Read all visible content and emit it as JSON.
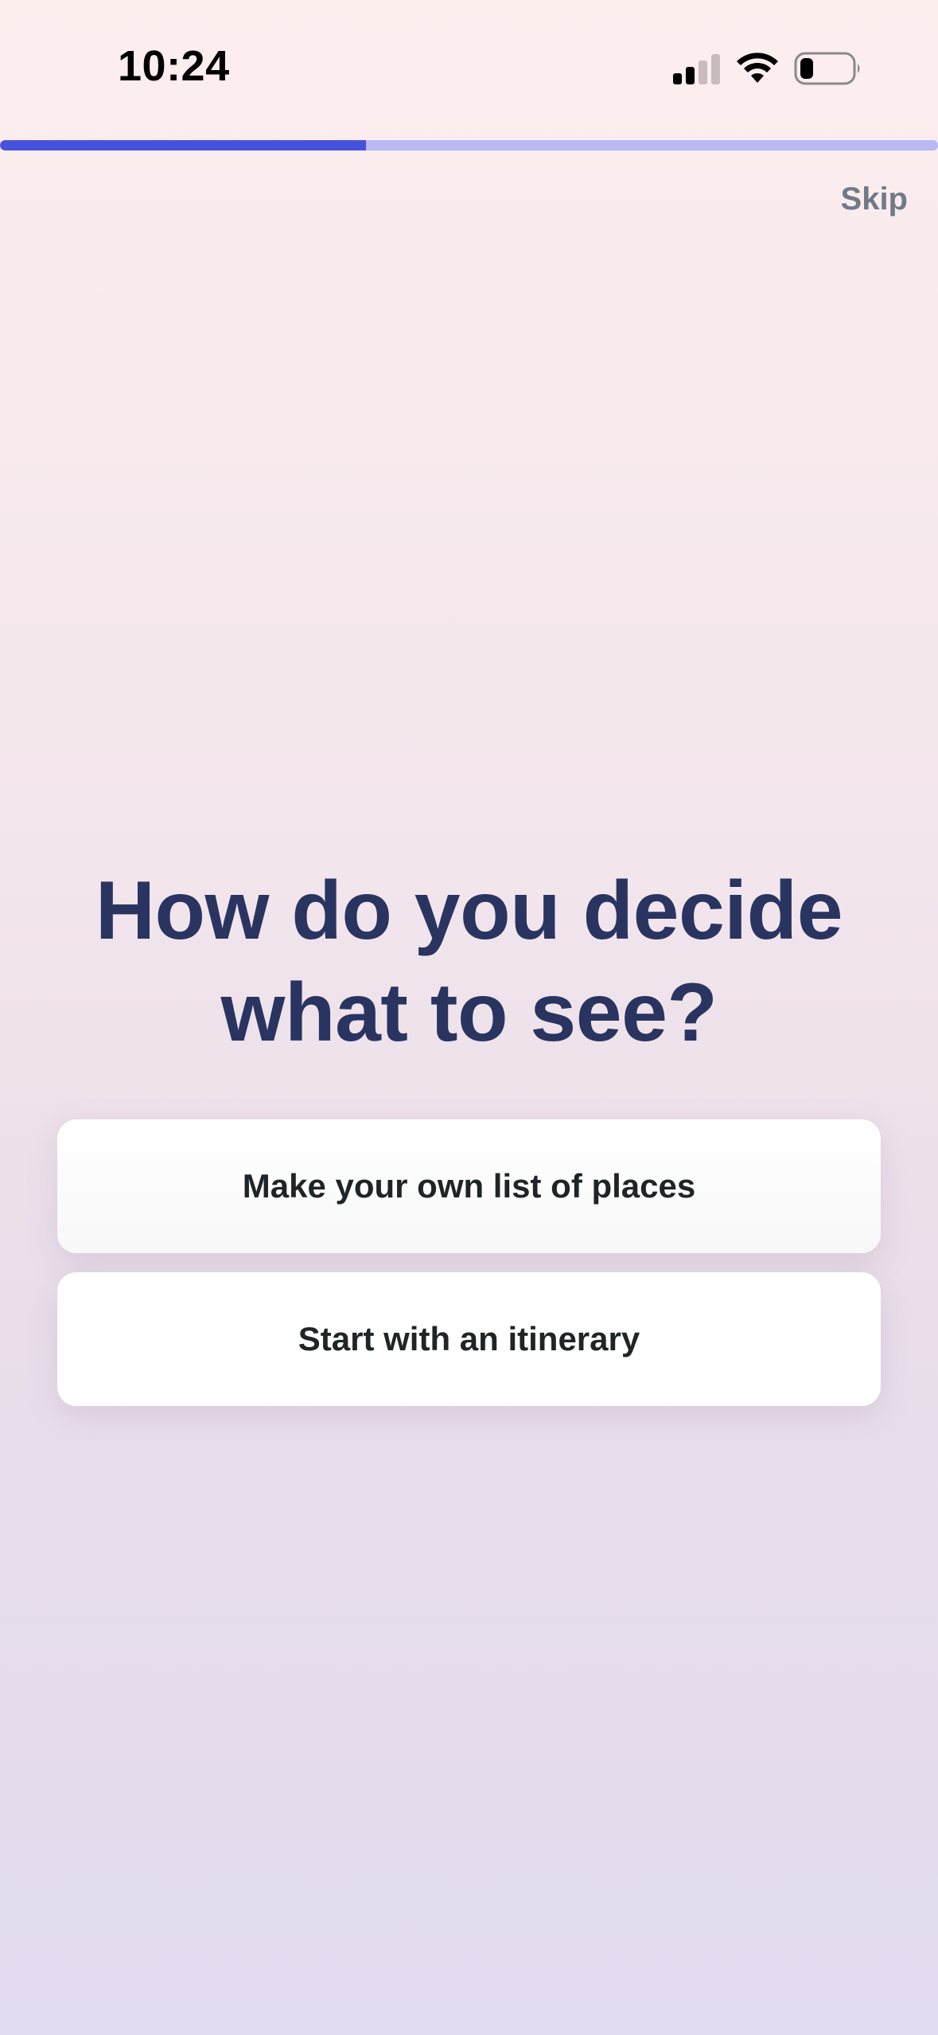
{
  "status_bar": {
    "time": "10:24",
    "icons": [
      "cellular-signal-icon",
      "wifi-icon",
      "battery-icon"
    ]
  },
  "progress": {
    "fraction": 0.39,
    "fill_color": "#4752dc",
    "track_color": "#b9b8f2"
  },
  "header": {
    "skip_label": "Skip"
  },
  "main": {
    "question": "How do you decide what to see?",
    "options": [
      {
        "label": "Make your own list of places"
      },
      {
        "label": "Start with an itinerary"
      }
    ]
  }
}
